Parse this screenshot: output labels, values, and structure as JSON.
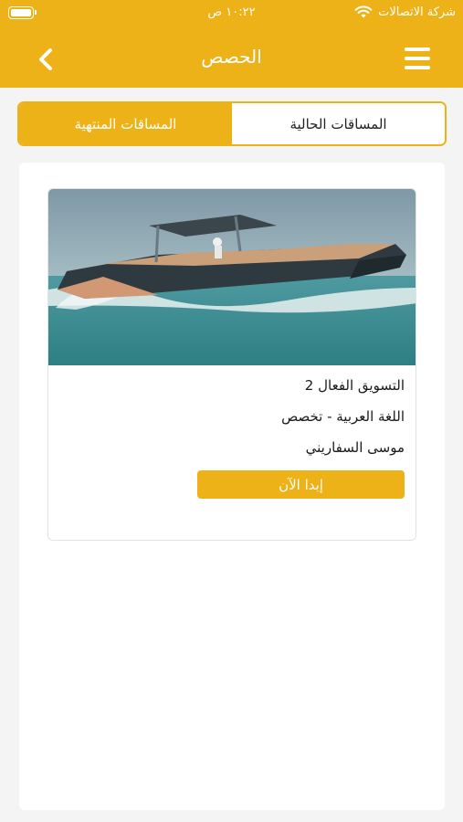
{
  "status_bar": {
    "carrier": "شركة الاتصالات",
    "time": "١٠:٢٢ ص",
    "wifi_icon": "wifi-icon",
    "battery_icon": "battery-icon"
  },
  "header": {
    "title": "الحصص",
    "back_icon": "chevron-left-icon",
    "menu_icon": "hamburger-menu-icon",
    "background_color": "#eeb219"
  },
  "tabs": [
    {
      "label": "المساقات الحالية",
      "selected": true
    },
    {
      "label": "المساقات المنتهية",
      "selected": false
    }
  ],
  "courses": [
    {
      "image": "speedboat-on-water-photo",
      "title": "التسويق الفعال 2",
      "subtitle": "اللغة العربية - تخصص",
      "instructor": "موسى السفاريني",
      "start_label": "إبدا الآن"
    }
  ],
  "colors": {
    "accent": "#eeb219",
    "background": "#f4f4f4"
  }
}
